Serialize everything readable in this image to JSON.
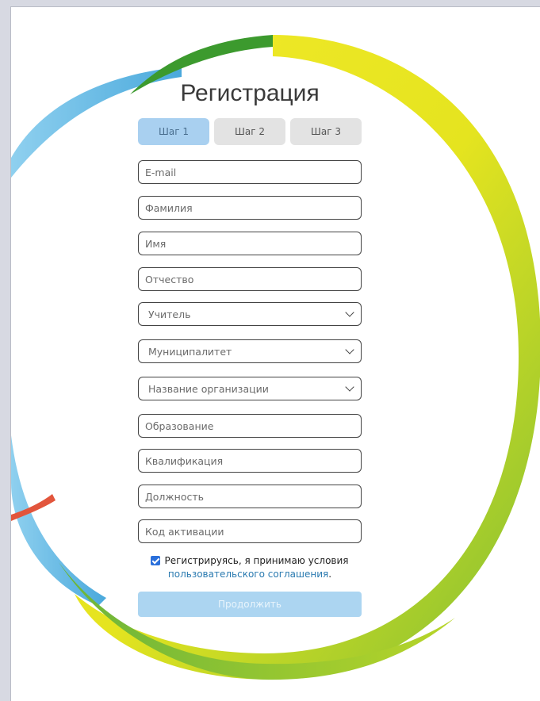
{
  "form": {
    "title": "Регистрация",
    "steps": [
      {
        "label": "Шаг 1",
        "active": true
      },
      {
        "label": "Шаг 2",
        "active": false
      },
      {
        "label": "Шаг 3",
        "active": false
      }
    ],
    "fields": {
      "email": {
        "placeholder": "E-mail"
      },
      "last_name": {
        "placeholder": "Фамилия"
      },
      "first_name": {
        "placeholder": "Имя"
      },
      "patronymic": {
        "placeholder": "Отчество"
      },
      "role": {
        "value": "Учитель"
      },
      "municipality": {
        "value": "Муниципалитет"
      },
      "organization": {
        "value": "Название организации"
      },
      "education": {
        "placeholder": "Образование"
      },
      "qualification": {
        "placeholder": "Квалификация"
      },
      "position": {
        "placeholder": "Должность"
      },
      "activation_code": {
        "placeholder": "Код активации"
      }
    },
    "agreement": {
      "checked": true,
      "text": "Регистрируясь, я принимаю условия",
      "link": "пользовательского соглашения",
      "suffix": "."
    },
    "continue_label": "Продолжить"
  },
  "colors": {
    "accent_blue": "#5bb6de",
    "accent_green": "#5fb836",
    "accent_yellow": "#f2e92a",
    "arrow": "#e2553c",
    "button_disabled": "#acd5f1"
  }
}
